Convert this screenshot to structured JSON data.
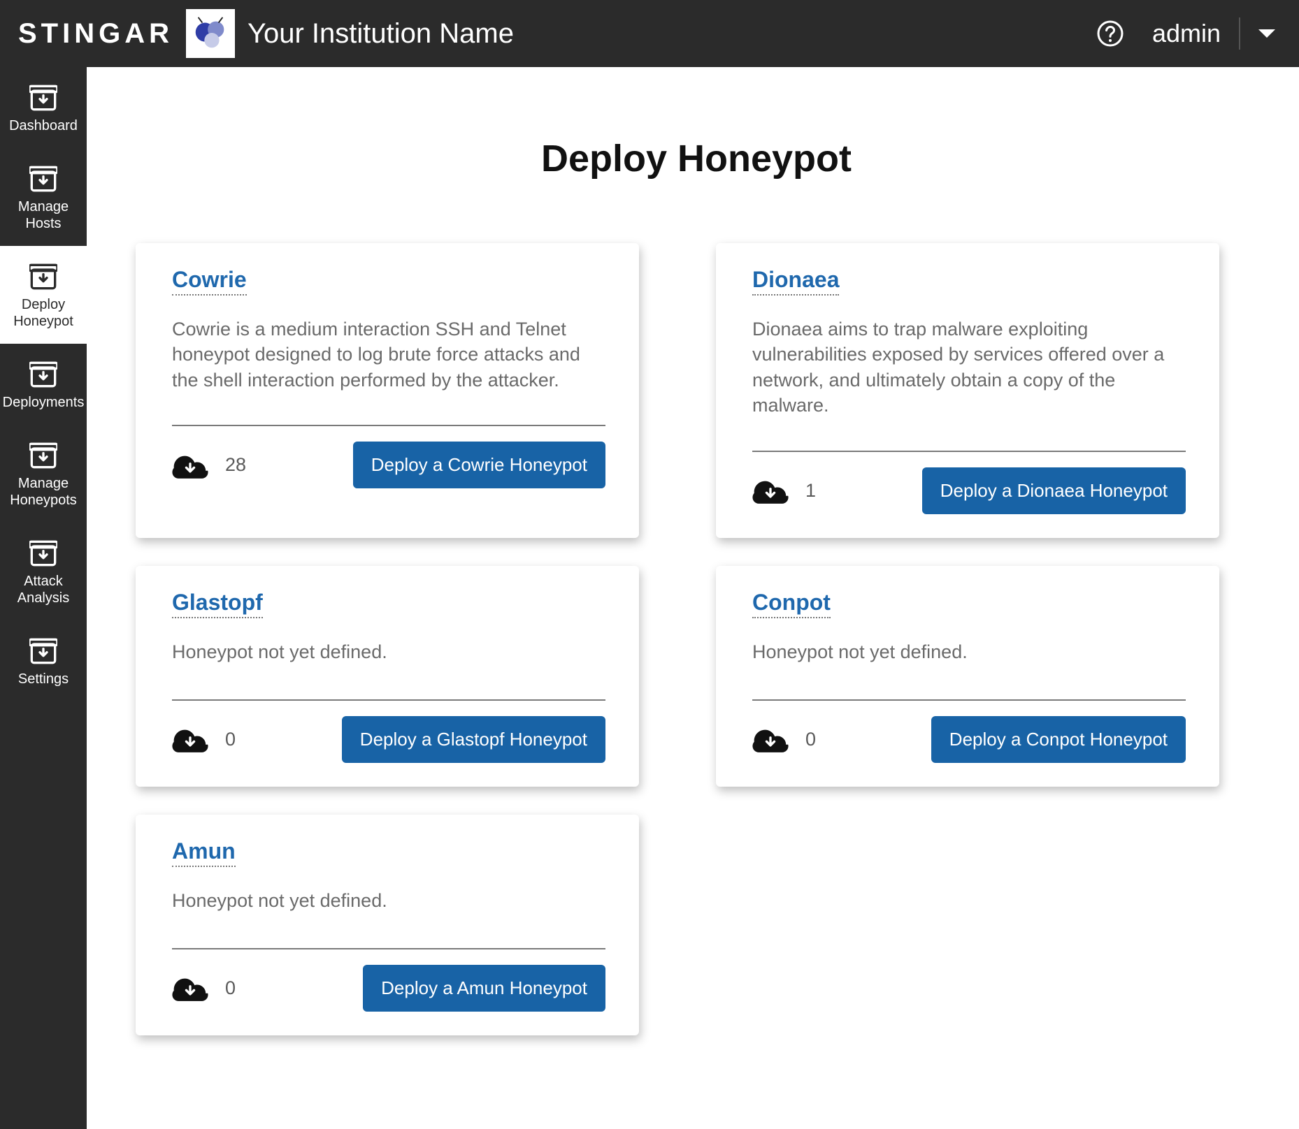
{
  "header": {
    "brand": "STINGAR",
    "institution": "Your Institution Name",
    "user": "admin"
  },
  "sidebar": {
    "items": [
      {
        "label": "Dashboard"
      },
      {
        "label": "Manage\nHosts"
      },
      {
        "label": "Deploy\nHoneypot"
      },
      {
        "label": "Deployments"
      },
      {
        "label": "Manage\nHoneypots"
      },
      {
        "label": "Attack\nAnalysis"
      },
      {
        "label": "Settings"
      }
    ]
  },
  "page": {
    "title": "Deploy Honeypot"
  },
  "honeypots": [
    {
      "name": "Cowrie",
      "description": "Cowrie is a medium interaction SSH and Telnet honeypot designed to log brute force attacks and the shell interaction performed by the attacker.",
      "count": "28",
      "deploy_label": "Deploy a Cowrie Honeypot"
    },
    {
      "name": "Dionaea",
      "description": "Dionaea aims to trap malware exploiting vulnerabilities exposed by services offered over a network, and ultimately obtain a copy of the malware.",
      "count": "1",
      "deploy_label": "Deploy a Dionaea Honeypot"
    },
    {
      "name": "Glastopf",
      "description": "Honeypot not yet defined.",
      "count": "0",
      "deploy_label": "Deploy a Glastopf Honeypot"
    },
    {
      "name": "Conpot",
      "description": "Honeypot not yet defined.",
      "count": "0",
      "deploy_label": "Deploy a Conpot Honeypot"
    },
    {
      "name": "Amun",
      "description": "Honeypot not yet defined.",
      "count": "0",
      "deploy_label": "Deploy a Amun Honeypot"
    }
  ]
}
